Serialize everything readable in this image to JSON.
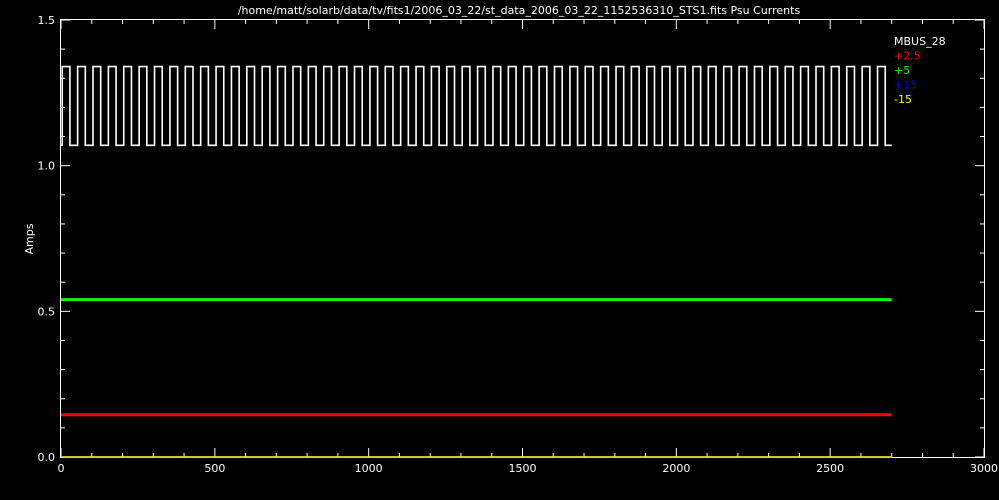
{
  "chart_data": {
    "type": "line",
    "title": "/home/matt/solarb/data/tv/fits1/2006_03_22/st_data_2006_03_22_1152536310_STS1.fits Psu Currents",
    "xlabel": "",
    "ylabel": "Amps",
    "xlim": [
      0,
      3000
    ],
    "ylim": [
      0,
      1.5
    ],
    "x_ticks": [
      0,
      500,
      1000,
      1500,
      2000,
      2500,
      3000
    ],
    "y_ticks": [
      0.0,
      0.5,
      1.0,
      1.5
    ],
    "x_tick_labels": [
      "0",
      "500",
      "1000",
      "1500",
      "2000",
      "2500",
      "3000"
    ],
    "y_tick_labels": [
      "0.0",
      "0.5",
      "1.0",
      "1.5"
    ],
    "legend_position": "top-right",
    "background": "#000000",
    "series": [
      {
        "name": "MBUS_28",
        "color": "#ffffff",
        "kind": "square_wave",
        "x_start": 0,
        "x_end": 2700,
        "low": 1.07,
        "high": 1.34,
        "cycles": 54
      },
      {
        "name": "+2.5",
        "color": "#ff0000",
        "kind": "constant",
        "x_start": 0,
        "x_end": 2700,
        "value": 0.145
      },
      {
        "name": "+5",
        "color": "#00ff00",
        "kind": "constant",
        "x_start": 0,
        "x_end": 2700,
        "value": 0.54
      },
      {
        "name": "+15",
        "color": "#0000ff",
        "kind": "constant",
        "x_start": 0,
        "x_end": 2700,
        "value": 0.0
      },
      {
        "name": "-15",
        "color": "#ffff00",
        "kind": "constant",
        "x_start": 0,
        "x_end": 2700,
        "value": 0.0
      }
    ]
  }
}
